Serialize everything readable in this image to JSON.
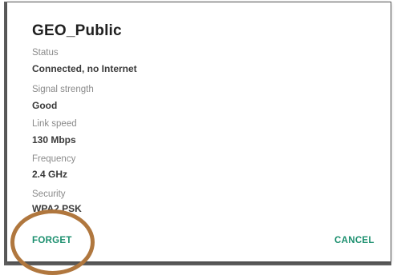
{
  "dialog": {
    "title": "GEO_Public",
    "fields": [
      {
        "label": "Status",
        "value": "Connected, no Internet"
      },
      {
        "label": "Signal strength",
        "value": "Good"
      },
      {
        "label": "Link speed",
        "value": "130 Mbps"
      },
      {
        "label": "Frequency",
        "value": "2.4 GHz"
      },
      {
        "label": "Security",
        "value": "WPA2 PSK"
      }
    ],
    "buttons": {
      "forget": "FORGET",
      "cancel": "CANCEL"
    }
  },
  "colors": {
    "accent": "#1b8f6e",
    "annotation_ring": "#b0773e"
  }
}
